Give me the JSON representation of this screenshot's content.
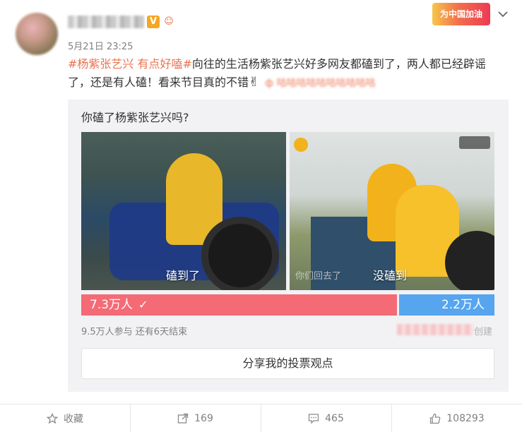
{
  "header": {
    "username": "",
    "vip_badge": "V",
    "fan_badge": "☺",
    "banner_text": "为中国加油"
  },
  "post": {
    "timestamp": "5月21日 23:25",
    "tag": "#杨紫张艺兴 有点好嗑#",
    "text": "向往的生活杨紫张艺兴好多网友都磕到了，两人都已经辟谣了，还是有人磕！看来节目真的不错",
    "emoji": "✌",
    "link_text": "ф 咕咕咕咕咕咕咕咕咕咕"
  },
  "poll": {
    "question": "你磕了杨紫张艺兴吗?",
    "options": [
      {
        "label": "磕到了",
        "votes": "7.3万人",
        "fraction": 0.768,
        "color": "#f46b75",
        "selected": true
      },
      {
        "label": "没磕到",
        "votes": "2.2万人",
        "fraction": 0.232,
        "color": "#57a5ef",
        "selected": false
      }
    ],
    "subtitle_b": "你们回去了",
    "meta": "9.5万人参与 还有6天结束",
    "creator_suffix": "创建",
    "share_label": "分享我的投票观点"
  },
  "actions": [
    {
      "icon": "star-icon",
      "label": "收藏"
    },
    {
      "icon": "share-icon",
      "label": "169"
    },
    {
      "icon": "comment-icon",
      "label": "465"
    },
    {
      "icon": "like-icon",
      "label": "108293"
    }
  ]
}
